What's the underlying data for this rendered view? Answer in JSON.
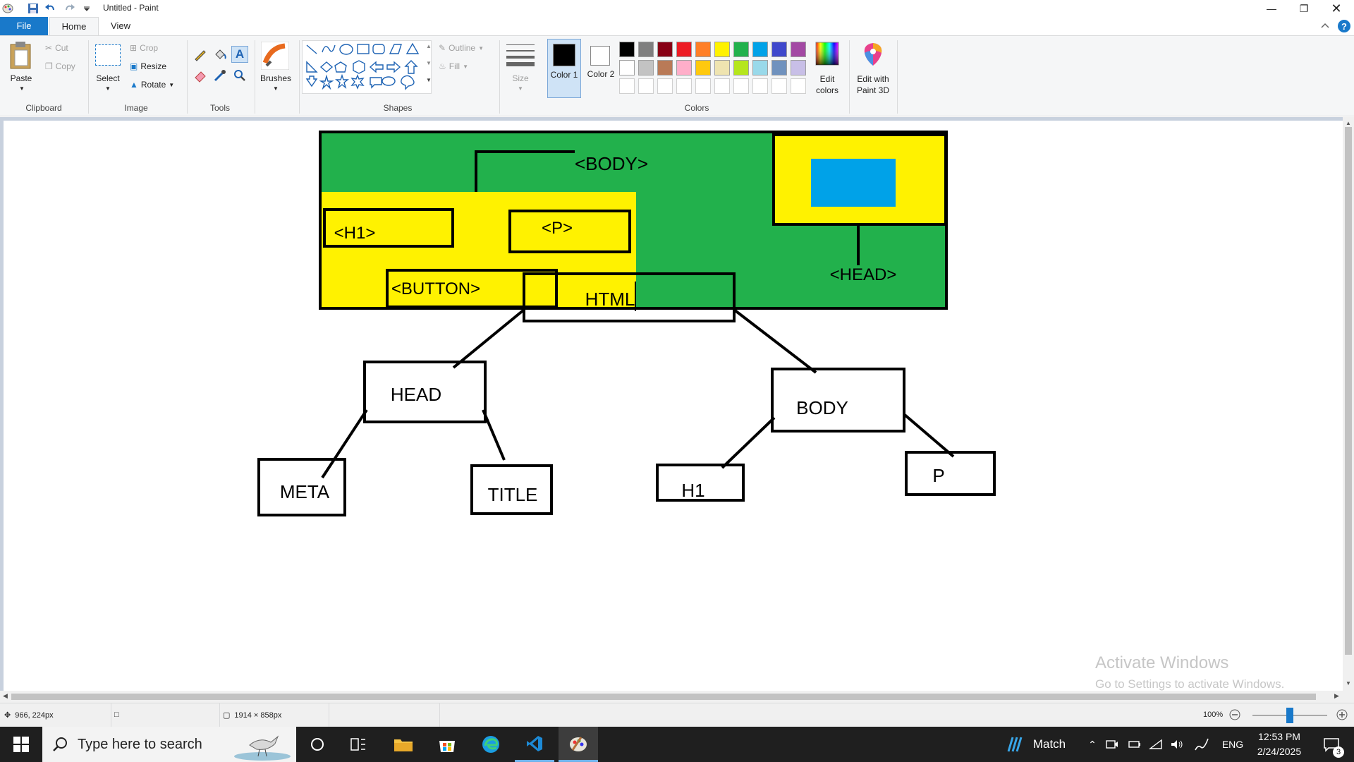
{
  "window": {
    "title": "Untitled - Paint"
  },
  "tabs": {
    "file": "File",
    "home": "Home",
    "view": "View"
  },
  "clipboard": {
    "paste": "Paste",
    "cut": "Cut",
    "copy": "Copy",
    "group": "Clipboard"
  },
  "image": {
    "select": "Select",
    "crop": "Crop",
    "resize": "Resize",
    "rotate": "Rotate",
    "group": "Image"
  },
  "tools": {
    "group": "Tools"
  },
  "brushes": {
    "label": "Brushes"
  },
  "shapes": {
    "outline": "Outline",
    "fill": "Fill",
    "group": "Shapes"
  },
  "size": {
    "label": "Size"
  },
  "colors": {
    "color1": "Color 1",
    "color2": "Color 2",
    "edit": "Edit colors",
    "group": "Colors",
    "paint3d": "Edit with Paint 3D",
    "color1_value": "#000000",
    "color2_value": "#ffffff",
    "palette_row1": [
      "#000000",
      "#7f7f7f",
      "#880015",
      "#ed1c24",
      "#ff7f27",
      "#fff200",
      "#22b14c",
      "#00a2e8",
      "#3f48cc",
      "#a349a4"
    ],
    "palette_row2": [
      "#ffffff",
      "#c3c3c3",
      "#b97a57",
      "#ffaec9",
      "#ffc90e",
      "#efe4b0",
      "#b5e61d",
      "#99d9ea",
      "#7092be",
      "#c8bfe7"
    ]
  },
  "drawing": {
    "body_label": "<BODY>",
    "h1_label": "<H1>",
    "p_label": "<P>",
    "button_label": "<BUTTON>",
    "head_label": "<HEAD>",
    "tree": {
      "html": "HTML",
      "head": "HEAD",
      "body": "BODY",
      "meta": "META",
      "title": "TITLE",
      "h1": "H1",
      "p": "P"
    },
    "colors": {
      "green": "#22b14c",
      "yellow": "#fff200",
      "blue": "#00a2e8"
    }
  },
  "watermark": {
    "line1": "Activate Windows",
    "line2": "Go to Settings to activate Windows."
  },
  "status": {
    "cursor": "966, 224px",
    "canvas_size": "1914 × 858px",
    "zoom": "100%"
  },
  "taskbar": {
    "search_placeholder": "Type here to search",
    "match": "Match",
    "lang": "ENG",
    "time": "12:53 PM",
    "date": "2/24/2025",
    "notif_count": "3"
  }
}
